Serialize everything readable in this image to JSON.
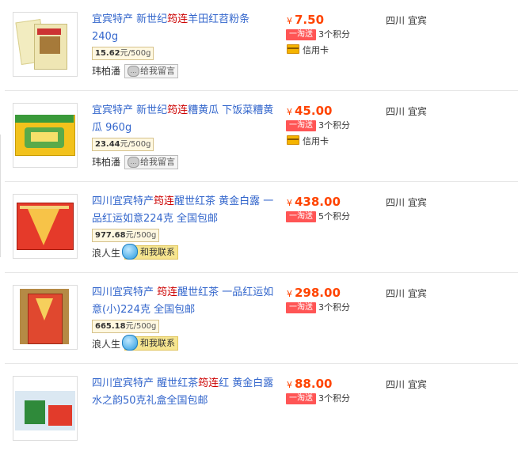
{
  "products": [
    {
      "title_parts": [
        "宜宾特产 新世纪",
        "筠连",
        "羊田红苕粉条 240g"
      ],
      "unit_price": "15.62",
      "unit_suffix": "元/500g",
      "seller": "玮柏潘",
      "seller_action": "给我留言",
      "price": "7.50",
      "currency": "¥",
      "promo_tag": "一淘送",
      "points": "3个积分",
      "payment": "信用卡",
      "location": "四川 宜宾"
    },
    {
      "title_parts": [
        "宜宾特产 新世纪",
        "筠连",
        "糟黄瓜 下饭菜糟黄瓜 960g"
      ],
      "unit_price": "23.44",
      "unit_suffix": "元/500g",
      "seller": "玮柏潘",
      "seller_action": "给我留言",
      "price": "45.00",
      "currency": "¥",
      "promo_tag": "一淘送",
      "points": "3个积分",
      "payment": "信用卡",
      "location": "四川 宜宾"
    },
    {
      "title_parts": [
        "四川宜宾特产",
        "筠连",
        "醒世红茶 黄金白露 一品红运如意224克 全国包邮"
      ],
      "unit_price": "977.68",
      "unit_suffix": "元/500g",
      "seller": "浪人生",
      "seller_action": "和我联系",
      "price": "438.00",
      "currency": "¥",
      "promo_tag": "一淘送",
      "points": "5个积分",
      "location": "四川 宜宾"
    },
    {
      "title_parts": [
        "四川宜宾特产 ",
        "筠连",
        "醒世红茶 一品红运如意(小)224克 全国包邮"
      ],
      "unit_price": "665.18",
      "unit_suffix": "元/500g",
      "seller": "浪人生",
      "seller_action": "和我联系",
      "price": "298.00",
      "currency": "¥",
      "promo_tag": "一淘送",
      "points": "3个积分",
      "location": "四川 宜宾"
    },
    {
      "title_parts": [
        "四川宜宾特产 醒世红茶",
        "筠连",
        "红 黄金白露 水之韵50克礼盒全国包邮"
      ],
      "price": "88.00",
      "currency": "¥",
      "promo_tag": "一淘送",
      "points": "3个积分",
      "location": "四川 宜宾"
    }
  ]
}
